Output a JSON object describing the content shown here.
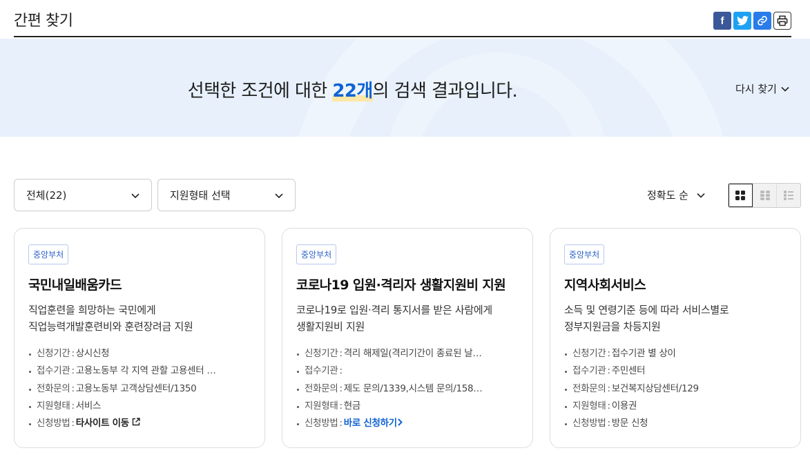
{
  "header": {
    "title": "간편 찾기"
  },
  "share": {
    "facebook": "f"
  },
  "banner": {
    "prefix": "선택한 조건에 대한 ",
    "count": "22개",
    "suffix": "의 검색 결과입니다.",
    "research_label": "다시 찾기"
  },
  "filters": {
    "category": "전체(22)",
    "support_type": "지원형태 선택",
    "sort": "정확도 순"
  },
  "cards": [
    {
      "tag": "중앙부처",
      "title": "국민내일배움카드",
      "desc1": "직업훈련을 희망하는 국민에게",
      "desc2": "직업능력개발훈련비와 훈련장려금 지원",
      "period_label": "신청기간",
      "period": "상시신청",
      "agency_label": "접수기관",
      "agency": "고용노동부 각 지역 관할 고용센터 …",
      "phone_label": "전화문의",
      "phone": "고용노동부 고객상담센터/1350",
      "type_label": "지원형태",
      "type": "서비스",
      "method_label": "신청방법",
      "method": "타사이트 이동"
    },
    {
      "tag": "중앙부처",
      "title": "코로나19 입원·격리자 생활지원비 지원",
      "desc1": "코로나19로 입원·격리 통지서를 받은 사람에게",
      "desc2": "생활지원비 지원",
      "period_label": "신청기간",
      "period": "격리 해제일(격리기간이 종료된 날…",
      "agency_label": "접수기관",
      "agency": "",
      "phone_label": "전화문의",
      "phone": "제도 문의/1339,시스템 문의/158…",
      "type_label": "지원형태",
      "type": "현금",
      "method_label": "신청방법",
      "method": "바로 신청하기"
    },
    {
      "tag": "중앙부처",
      "title": "지역사회서비스",
      "desc1": "소득 및 연령기준 등에 따라 서비스별로",
      "desc2": "정부지원금을 차등지원",
      "period_label": "신청기간",
      "period": "접수기관 별 상이",
      "agency_label": "접수기관",
      "agency": "주민센터",
      "phone_label": "전화문의",
      "phone": "보건복지상담센터/129",
      "type_label": "지원형태",
      "type": "이용권",
      "method_label": "신청방법",
      "method": "방문 신청"
    }
  ]
}
